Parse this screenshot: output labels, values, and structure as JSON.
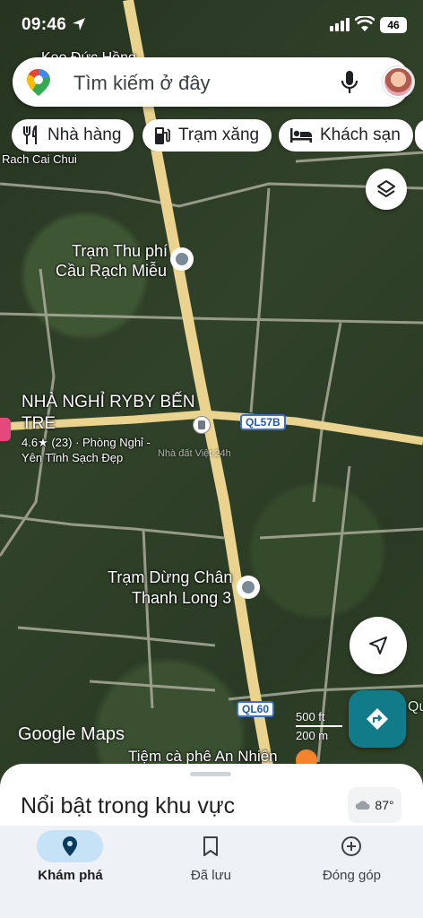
{
  "status_bar": {
    "time": "09:46",
    "battery": "46"
  },
  "search": {
    "placeholder": "Tìm kiếm ở đây"
  },
  "chips": [
    {
      "label": "Nhà hàng",
      "icon": "restaurant-icon"
    },
    {
      "label": "Trạm xăng",
      "icon": "gas-station-icon"
    },
    {
      "label": "Khách sạn",
      "icon": "hotel-icon"
    }
  ],
  "map": {
    "labels": {
      "top_partial": "Keo Đức Hồng",
      "rach_cai_chui": "Rach Cai Chui",
      "toll_line1": "Trạm Thu phí",
      "toll_line2": "Cầu Rạch Miễu",
      "hotel_line1": "NHÀ NGHỈ RYBY BẾN",
      "hotel_line2": "TRE",
      "hotel_rating": "4.6★ (23) · Phòng Nghỉ -",
      "hotel_desc": "Yên Tĩnh Sạch Đẹp",
      "stop_line1": "Trạm Dừng Chân",
      "stop_line2": "Thanh Long 3",
      "cafe": "Tiệm cà phê An Nhiên",
      "right_partial": "Qu",
      "watermark": "Nhà đất Việt 24h"
    },
    "road_shields": {
      "ql57b": "QL57B",
      "ql60": "QL60"
    },
    "scale": {
      "top": "500 ft",
      "bottom": "200 m"
    },
    "logo": "Google Maps"
  },
  "sheet": {
    "title": "Nổi bật trong khu vực",
    "weather_temp": "87°"
  },
  "bottom_nav": [
    {
      "label": "Khám phá",
      "icon": "explore-pin-icon",
      "active": true
    },
    {
      "label": "Đã lưu",
      "icon": "bookmark-icon",
      "active": false
    },
    {
      "label": "Đóng góp",
      "icon": "add-circle-icon",
      "active": false
    }
  ],
  "colors": {
    "accent": "#127b8a",
    "nav_active_bg": "#c5e2f7",
    "road": "#e9d38f"
  }
}
